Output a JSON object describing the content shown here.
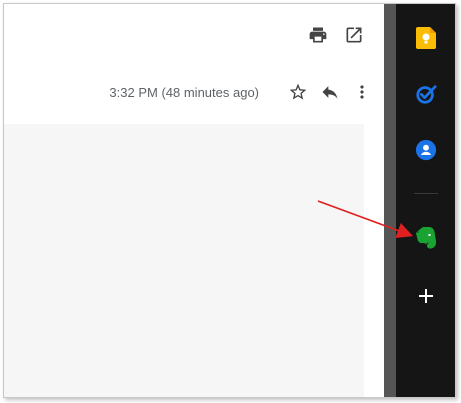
{
  "email": {
    "timestamp": "3:32 PM (48 minutes ago)"
  },
  "icons": {
    "print": "print-icon",
    "open_in_new": "open-in-new-icon",
    "star": "star-icon",
    "reply": "reply-icon",
    "more": "more-vert-icon"
  },
  "side_panel": {
    "apps": [
      {
        "name": "Keep",
        "icon": "keep-icon",
        "color": "#fbbc04"
      },
      {
        "name": "Tasks",
        "icon": "tasks-icon",
        "color": "#1a73e8"
      },
      {
        "name": "Contacts",
        "icon": "contacts-icon",
        "color": "#1a73e8"
      },
      {
        "name": "Evernote",
        "icon": "evernote-icon",
        "color": "#1aa333"
      }
    ],
    "add_icon": "plus-icon"
  },
  "annotation": {
    "arrow_color": "#e02020"
  }
}
